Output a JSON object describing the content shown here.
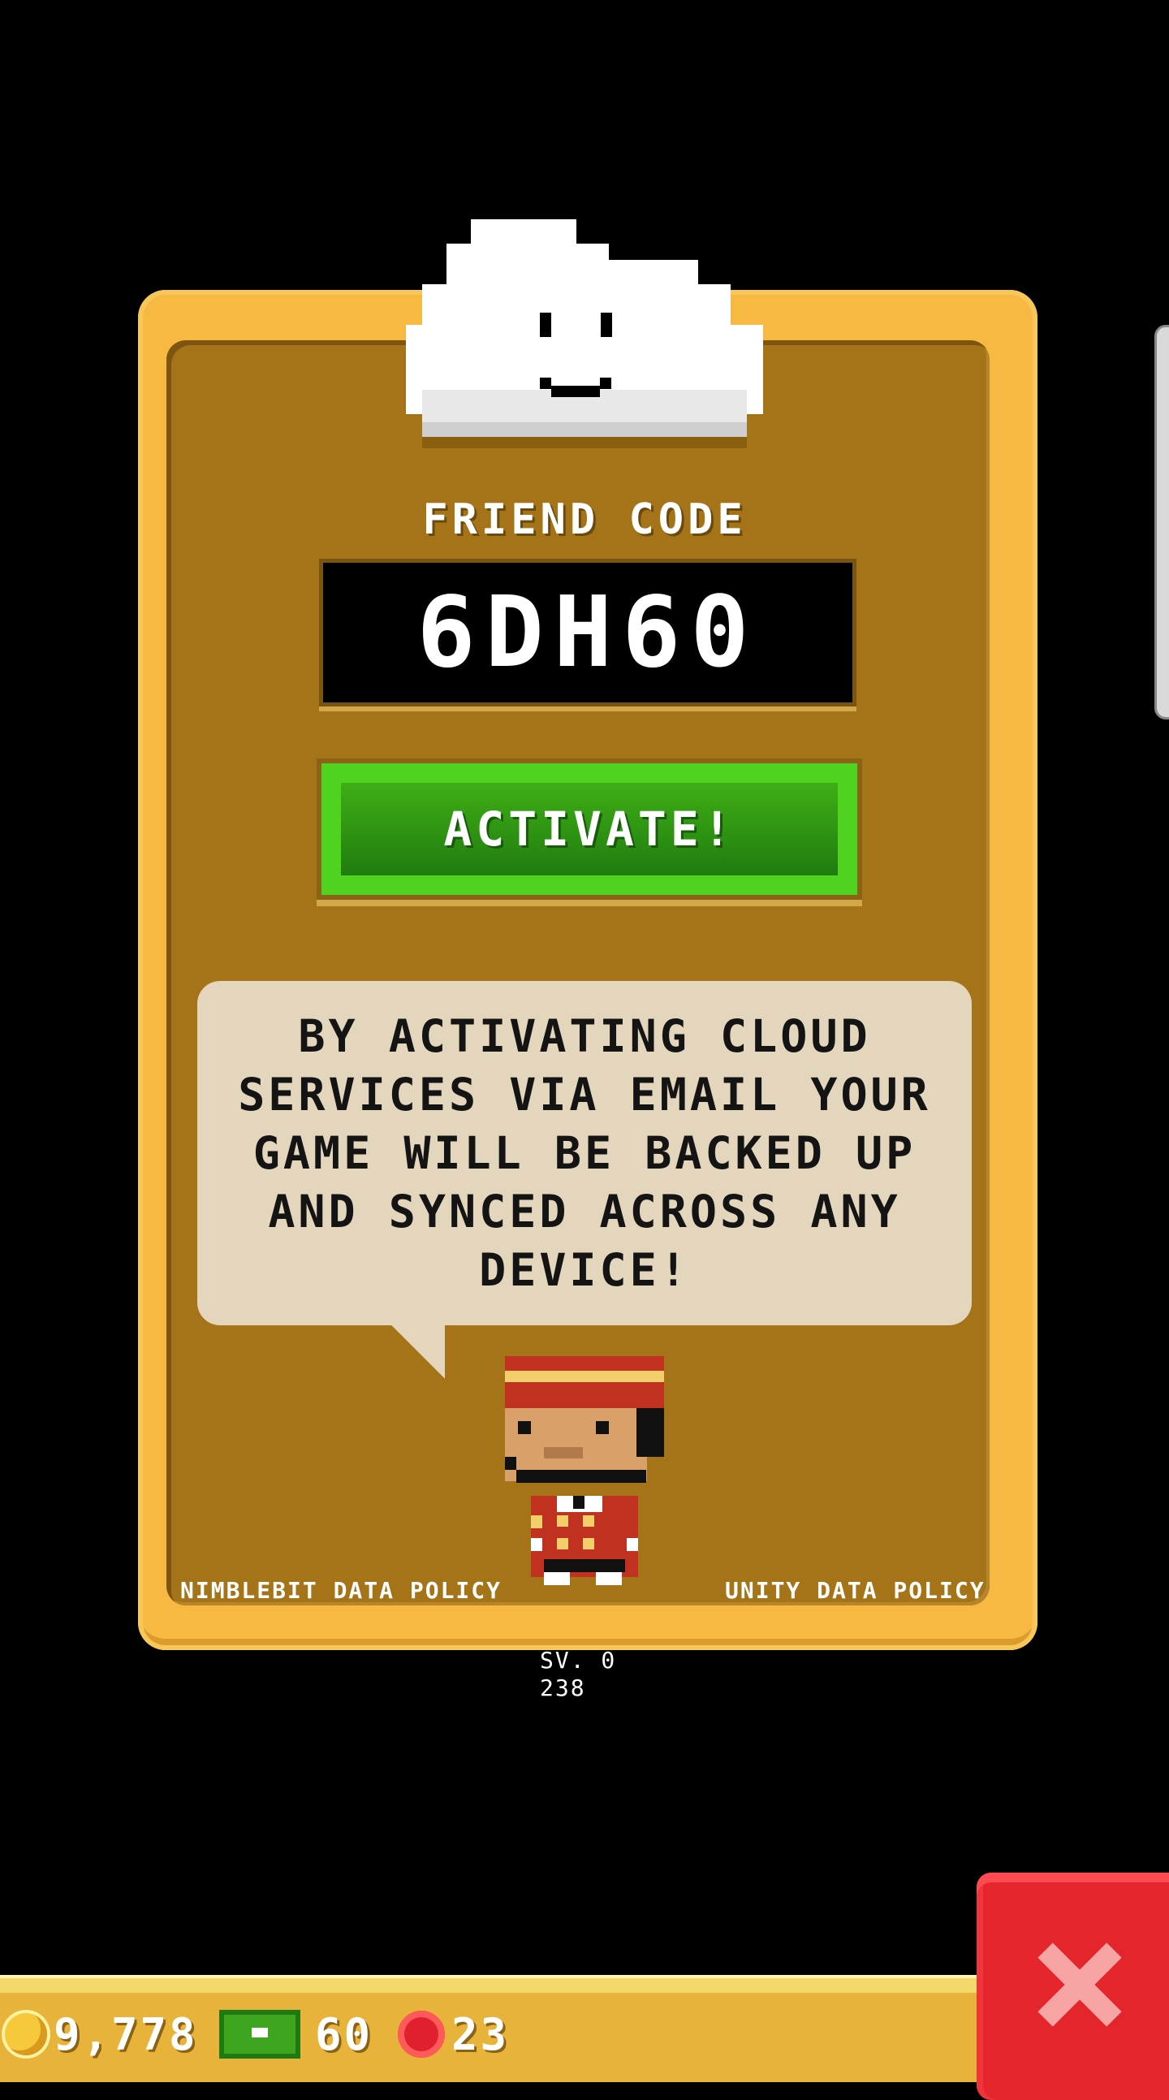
{
  "panel": {
    "friend_code_label": "FRIEND CODE",
    "friend_code": "6DH60",
    "activate_label": "ACTIVATE!",
    "message": "BY ACTIVATING CLOUD SERVICES VIA EMAIL YOUR GAME WILL BE BACKED UP AND SYNCED ACROSS ANY DEVICE!",
    "nimblebit_policy": "NIMBLEBIT DATA POLICY",
    "unity_policy": "UNITY DATA POLICY"
  },
  "version": {
    "line1": "SV. 0",
    "line2": "238"
  },
  "currency": {
    "coins": "9,778",
    "bux": "60",
    "chips": "23"
  },
  "icons": {
    "cloud": "smiling-cloud-icon",
    "character": "bellhop-character",
    "coin": "coin-icon",
    "bux": "tower-bux-icon",
    "chip": "golden-ticket-chip-icon",
    "close": "close-icon"
  },
  "colors": {
    "panel_border": "#f7b942",
    "panel_fill": "#a57418",
    "activate": "#4fd31e",
    "close": "#e4262c"
  }
}
